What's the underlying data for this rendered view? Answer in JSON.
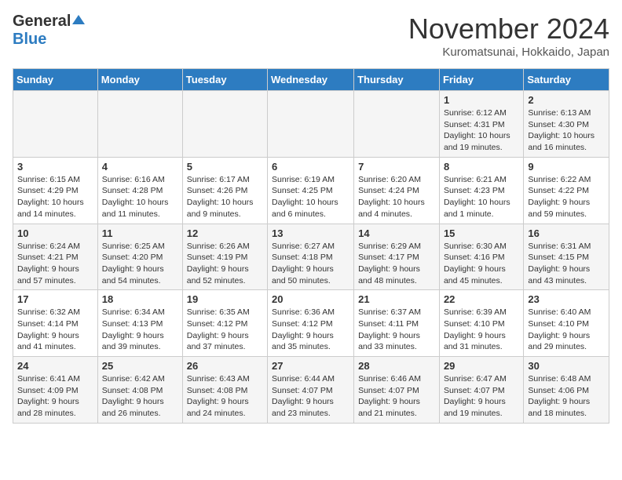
{
  "header": {
    "logo_general": "General",
    "logo_blue": "Blue",
    "month_title": "November 2024",
    "location": "Kuromatsunai, Hokkaido, Japan"
  },
  "days_of_week": [
    "Sunday",
    "Monday",
    "Tuesday",
    "Wednesday",
    "Thursday",
    "Friday",
    "Saturday"
  ],
  "weeks": [
    [
      {
        "day": "",
        "info": ""
      },
      {
        "day": "",
        "info": ""
      },
      {
        "day": "",
        "info": ""
      },
      {
        "day": "",
        "info": ""
      },
      {
        "day": "",
        "info": ""
      },
      {
        "day": "1",
        "info": "Sunrise: 6:12 AM\nSunset: 4:31 PM\nDaylight: 10 hours and 19 minutes."
      },
      {
        "day": "2",
        "info": "Sunrise: 6:13 AM\nSunset: 4:30 PM\nDaylight: 10 hours and 16 minutes."
      }
    ],
    [
      {
        "day": "3",
        "info": "Sunrise: 6:15 AM\nSunset: 4:29 PM\nDaylight: 10 hours and 14 minutes."
      },
      {
        "day": "4",
        "info": "Sunrise: 6:16 AM\nSunset: 4:28 PM\nDaylight: 10 hours and 11 minutes."
      },
      {
        "day": "5",
        "info": "Sunrise: 6:17 AM\nSunset: 4:26 PM\nDaylight: 10 hours and 9 minutes."
      },
      {
        "day": "6",
        "info": "Sunrise: 6:19 AM\nSunset: 4:25 PM\nDaylight: 10 hours and 6 minutes."
      },
      {
        "day": "7",
        "info": "Sunrise: 6:20 AM\nSunset: 4:24 PM\nDaylight: 10 hours and 4 minutes."
      },
      {
        "day": "8",
        "info": "Sunrise: 6:21 AM\nSunset: 4:23 PM\nDaylight: 10 hours and 1 minute."
      },
      {
        "day": "9",
        "info": "Sunrise: 6:22 AM\nSunset: 4:22 PM\nDaylight: 9 hours and 59 minutes."
      }
    ],
    [
      {
        "day": "10",
        "info": "Sunrise: 6:24 AM\nSunset: 4:21 PM\nDaylight: 9 hours and 57 minutes."
      },
      {
        "day": "11",
        "info": "Sunrise: 6:25 AM\nSunset: 4:20 PM\nDaylight: 9 hours and 54 minutes."
      },
      {
        "day": "12",
        "info": "Sunrise: 6:26 AM\nSunset: 4:19 PM\nDaylight: 9 hours and 52 minutes."
      },
      {
        "day": "13",
        "info": "Sunrise: 6:27 AM\nSunset: 4:18 PM\nDaylight: 9 hours and 50 minutes."
      },
      {
        "day": "14",
        "info": "Sunrise: 6:29 AM\nSunset: 4:17 PM\nDaylight: 9 hours and 48 minutes."
      },
      {
        "day": "15",
        "info": "Sunrise: 6:30 AM\nSunset: 4:16 PM\nDaylight: 9 hours and 45 minutes."
      },
      {
        "day": "16",
        "info": "Sunrise: 6:31 AM\nSunset: 4:15 PM\nDaylight: 9 hours and 43 minutes."
      }
    ],
    [
      {
        "day": "17",
        "info": "Sunrise: 6:32 AM\nSunset: 4:14 PM\nDaylight: 9 hours and 41 minutes."
      },
      {
        "day": "18",
        "info": "Sunrise: 6:34 AM\nSunset: 4:13 PM\nDaylight: 9 hours and 39 minutes."
      },
      {
        "day": "19",
        "info": "Sunrise: 6:35 AM\nSunset: 4:12 PM\nDaylight: 9 hours and 37 minutes."
      },
      {
        "day": "20",
        "info": "Sunrise: 6:36 AM\nSunset: 4:12 PM\nDaylight: 9 hours and 35 minutes."
      },
      {
        "day": "21",
        "info": "Sunrise: 6:37 AM\nSunset: 4:11 PM\nDaylight: 9 hours and 33 minutes."
      },
      {
        "day": "22",
        "info": "Sunrise: 6:39 AM\nSunset: 4:10 PM\nDaylight: 9 hours and 31 minutes."
      },
      {
        "day": "23",
        "info": "Sunrise: 6:40 AM\nSunset: 4:10 PM\nDaylight: 9 hours and 29 minutes."
      }
    ],
    [
      {
        "day": "24",
        "info": "Sunrise: 6:41 AM\nSunset: 4:09 PM\nDaylight: 9 hours and 28 minutes."
      },
      {
        "day": "25",
        "info": "Sunrise: 6:42 AM\nSunset: 4:08 PM\nDaylight: 9 hours and 26 minutes."
      },
      {
        "day": "26",
        "info": "Sunrise: 6:43 AM\nSunset: 4:08 PM\nDaylight: 9 hours and 24 minutes."
      },
      {
        "day": "27",
        "info": "Sunrise: 6:44 AM\nSunset: 4:07 PM\nDaylight: 9 hours and 23 minutes."
      },
      {
        "day": "28",
        "info": "Sunrise: 6:46 AM\nSunset: 4:07 PM\nDaylight: 9 hours and 21 minutes."
      },
      {
        "day": "29",
        "info": "Sunrise: 6:47 AM\nSunset: 4:07 PM\nDaylight: 9 hours and 19 minutes."
      },
      {
        "day": "30",
        "info": "Sunrise: 6:48 AM\nSunset: 4:06 PM\nDaylight: 9 hours and 18 minutes."
      }
    ]
  ]
}
